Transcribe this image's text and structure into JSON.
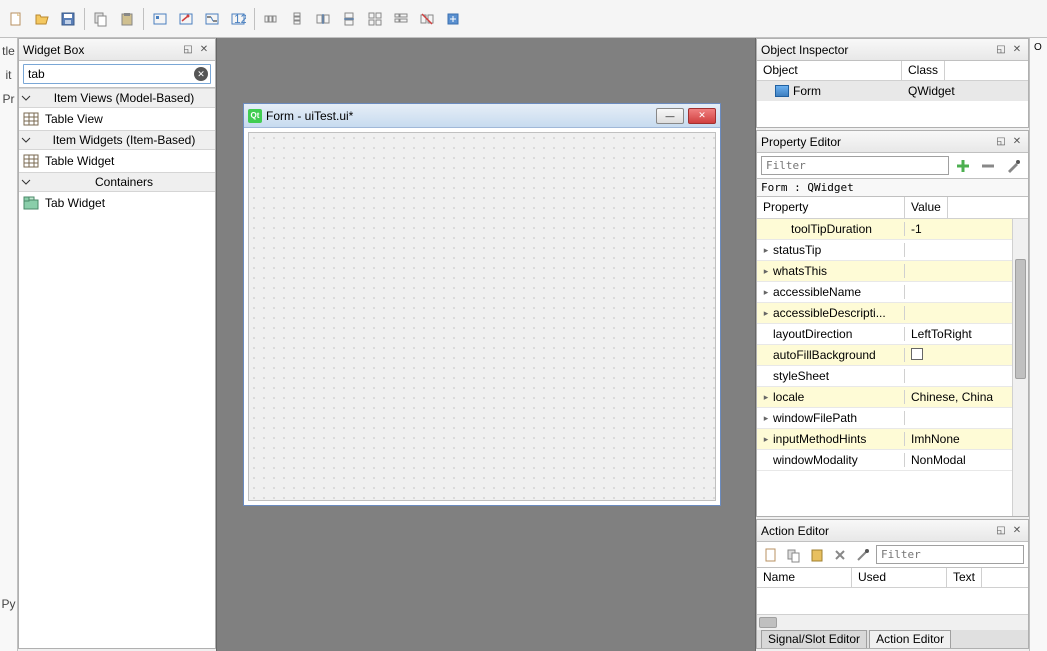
{
  "toolbar": {
    "icons": [
      "new-file",
      "open-file",
      "save-file",
      "sep",
      "copy",
      "paste",
      "sep",
      "edit-widgets",
      "edit-signals",
      "edit-buddies",
      "edit-tab-order",
      "sep",
      "layout-h",
      "layout-v",
      "layout-hsplit",
      "layout-vsplit",
      "layout-grid",
      "layout-form",
      "break-layout",
      "adjust-size"
    ]
  },
  "widget_box": {
    "title": "Widget Box",
    "search_value": "tab",
    "categories": [
      {
        "label": "Item Views (Model-Based)",
        "items": [
          {
            "label": "Table View",
            "icon": "table-icon"
          }
        ]
      },
      {
        "label": "Item Widgets (Item-Based)",
        "items": [
          {
            "label": "Table Widget",
            "icon": "table-icon"
          }
        ]
      },
      {
        "label": "Containers",
        "items": [
          {
            "label": "Tab Widget",
            "icon": "tab-widget-icon"
          }
        ]
      }
    ]
  },
  "canvas": {
    "form_title": "Form - uiTest.ui*"
  },
  "object_inspector": {
    "title": "Object Inspector",
    "headers": {
      "object": "Object",
      "class": "Class"
    },
    "rows": [
      {
        "object": "Form",
        "class": "QWidget"
      }
    ]
  },
  "property_editor": {
    "title": "Property Editor",
    "filter_placeholder": "Filter",
    "path": "Form : QWidget",
    "headers": {
      "property": "Property",
      "value": "Value"
    },
    "rows": [
      {
        "name": "toolTipDuration",
        "value": "-1",
        "yellow": true,
        "indent": true
      },
      {
        "name": "statusTip",
        "value": "",
        "expandable": true
      },
      {
        "name": "whatsThis",
        "value": "",
        "yellow": true,
        "expandable": true
      },
      {
        "name": "accessibleName",
        "value": "",
        "expandable": true
      },
      {
        "name": "accessibleDescripti...",
        "value": "",
        "yellow": true,
        "expandable": true
      },
      {
        "name": "layoutDirection",
        "value": "LeftToRight"
      },
      {
        "name": "autoFillBackground",
        "value": "",
        "yellow": true,
        "checkbox": true
      },
      {
        "name": "styleSheet",
        "value": ""
      },
      {
        "name": "locale",
        "value": "Chinese, China",
        "yellow": true,
        "expandable": true
      },
      {
        "name": "windowFilePath",
        "value": "",
        "expandable": true
      },
      {
        "name": "inputMethodHints",
        "value": "ImhNone",
        "yellow": true,
        "expandable": true
      },
      {
        "name": "windowModality",
        "value": "NonModal"
      }
    ]
  },
  "action_editor": {
    "title": "Action Editor",
    "filter_placeholder": "Filter",
    "headers": {
      "name": "Name",
      "used": "Used",
      "text": "Text"
    }
  },
  "bottom_tabs": {
    "signal_slot": "Signal/Slot Editor",
    "action": "Action Editor"
  },
  "left_labels": [
    "tle",
    "it",
    "Pr",
    ".",
    "Py"
  ],
  "right_label": "O"
}
